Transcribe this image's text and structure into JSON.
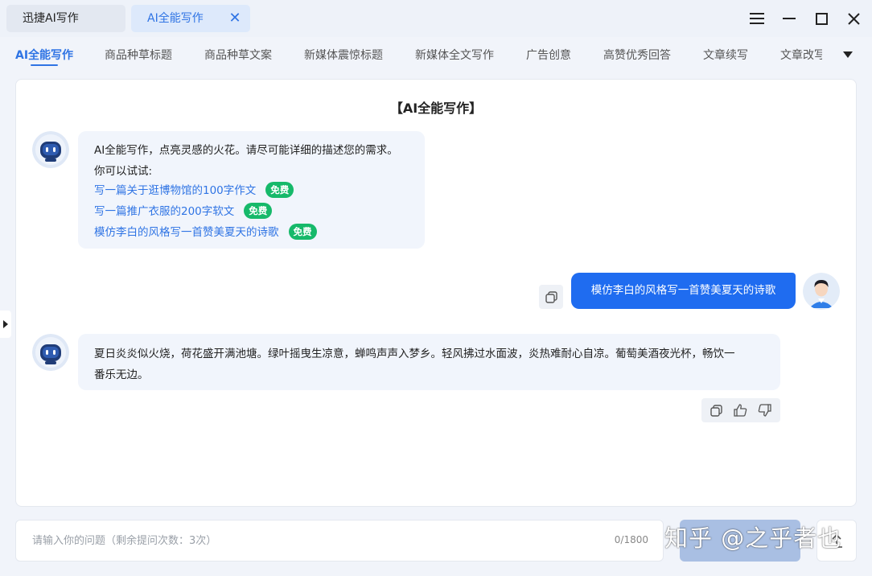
{
  "window": {
    "tabs": [
      {
        "label": "迅捷AI写作"
      },
      {
        "label": "AI全能写作",
        "active": true
      }
    ]
  },
  "categories": [
    "AI全能写作",
    "商品种草标题",
    "商品种草文案",
    "新媒体震惊标题",
    "新媒体全文写作",
    "广告创意",
    "高赞优秀回答",
    "文章续写",
    "文章改写"
  ],
  "panel": {
    "title": "【AI全能写作】",
    "greeting": {
      "intro": "AI全能写作，点亮灵感的火花。请尽可能详细的描述您的需求。",
      "try_label": "你可以试试:",
      "suggestions": [
        {
          "text": "写一篇关于逛博物馆的100字作文",
          "badge": "免费"
        },
        {
          "text": "写一篇推广衣服的200字软文",
          "badge": "免费"
        },
        {
          "text": "模仿李白的风格写一首赞美夏天的诗歌",
          "badge": "免费"
        }
      ]
    },
    "user_message": "模仿李白的风格写一首赞美夏天的诗歌",
    "reply": {
      "line1": "夏日炎炎似火烧，荷花盛开满池塘。绿叶摇曳生凉意，蝉鸣声声入梦乡。轻风拂过水面波，炎热难耐心自凉。葡萄美酒夜光杯，畅饮一",
      "line2": "番乐无边。"
    }
  },
  "input": {
    "placeholder": "请输入你的问题（剩余提问次数：3次）",
    "counter": "0/1800"
  },
  "watermark": "知乎 @之乎者也",
  "colors": {
    "accent": "#2f74e4",
    "user_bubble": "#1f6cf0",
    "free_badge": "#16b96a",
    "bot_bubble": "#f1f5fc"
  },
  "icons": {
    "menu": "hamburger-icon",
    "minimize": "minimize-icon",
    "maximize": "maximize-icon",
    "close": "close-icon",
    "more": "caret-down-icon",
    "copy": "copy-icon",
    "like": "thumbs-up-icon",
    "dislike": "thumbs-down-icon",
    "upload": "upload-icon"
  }
}
